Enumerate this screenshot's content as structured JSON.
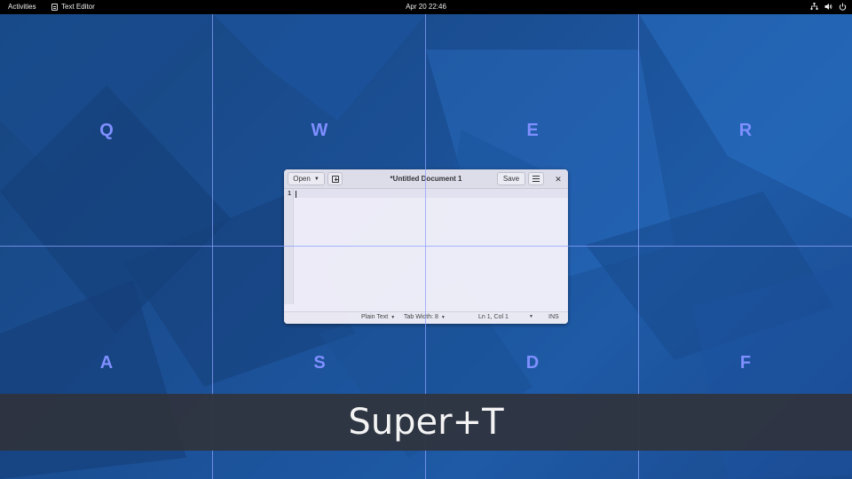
{
  "topbar": {
    "activities": "Activities",
    "app_name": "Text Editor",
    "app_icon": "text-editor-icon",
    "clock": "Apr 20  22:46",
    "tray_icons": [
      "network-icon",
      "volume-icon",
      "power-icon"
    ]
  },
  "grid": {
    "letters": [
      "Q",
      "W",
      "E",
      "R",
      "A",
      "S",
      "D",
      "F"
    ],
    "line_color": "#8ca0ff",
    "letter_color": "#7f8fff"
  },
  "editor": {
    "open_label": "Open",
    "title": "*Untitled Document 1",
    "save_label": "Save",
    "line_number": "1",
    "status": {
      "language": "Plain Text",
      "tab_width": "Tab Width: 8",
      "position": "Ln 1, Col 1",
      "mode": "INS"
    }
  },
  "banner": {
    "text": "Super+T"
  },
  "colors": {
    "wallpaper": "#1b4f94",
    "topbar": "#000000",
    "window_bg": "#f3f1fb",
    "banner_bg": "#2f333c"
  }
}
